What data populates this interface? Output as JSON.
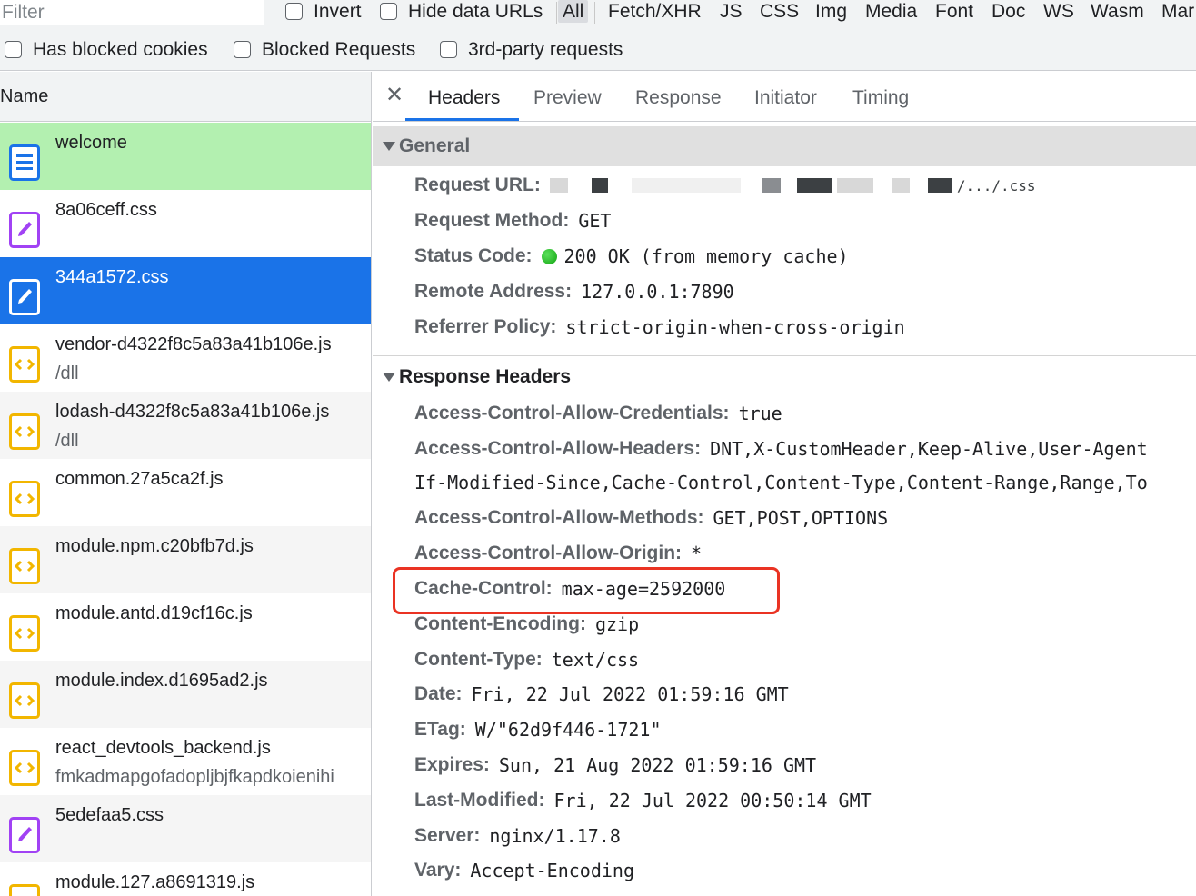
{
  "filter": {
    "placeholder": "Filter",
    "invert_label": "Invert",
    "hide_data_urls_label": "Hide data URLs",
    "types": [
      "All",
      "Fetch/XHR",
      "JS",
      "CSS",
      "Img",
      "Media",
      "Font",
      "Doc",
      "WS",
      "Wasm",
      "Mar"
    ],
    "has_blocked_cookies_label": "Has blocked cookies",
    "blocked_requests_label": "Blocked Requests",
    "third_party_label": "3rd-party requests"
  },
  "list": {
    "header": "Name",
    "requests": [
      {
        "name": "welcome",
        "sub": "",
        "kind": "doc",
        "state": "selected-green"
      },
      {
        "name": "8a06ceff.css",
        "sub": "",
        "kind": "css",
        "state": ""
      },
      {
        "name": "344a1572.css",
        "sub": "",
        "kind": "css",
        "state": "selected-blue"
      },
      {
        "name": "vendor-d4322f8c5a83a41b106e.js",
        "sub": "/dll",
        "kind": "js",
        "state": ""
      },
      {
        "name": "lodash-d4322f8c5a83a41b106e.js",
        "sub": "/dll",
        "kind": "js",
        "state": ""
      },
      {
        "name": "common.27a5ca2f.js",
        "sub": "",
        "kind": "js",
        "state": ""
      },
      {
        "name": "module.npm.c20bfb7d.js",
        "sub": "",
        "kind": "js",
        "state": ""
      },
      {
        "name": "module.antd.d19cf16c.js",
        "sub": "",
        "kind": "js",
        "state": ""
      },
      {
        "name": "module.index.d1695ad2.js",
        "sub": "",
        "kind": "js",
        "state": ""
      },
      {
        "name": "react_devtools_backend.js",
        "sub": "fmkadmapgofadopljbjfkapdkoienihi",
        "kind": "js",
        "state": ""
      },
      {
        "name": "5edefaa5.css",
        "sub": "",
        "kind": "css",
        "state": ""
      },
      {
        "name": "module.127.a8691319.js",
        "sub": "",
        "kind": "js",
        "state": ""
      }
    ]
  },
  "details": {
    "tabs": [
      "Headers",
      "Preview",
      "Response",
      "Initiator",
      "Timing"
    ],
    "active_tab": "Headers",
    "general": {
      "title": "General",
      "request_url_key": "Request URL:",
      "request_url_tail": "/.../.css",
      "rows": [
        {
          "key": "Request Method:",
          "value": "GET"
        },
        {
          "key": "Status Code:",
          "value": "200 OK (from memory cache)"
        },
        {
          "key": "Remote Address:",
          "value": "127.0.0.1:7890"
        },
        {
          "key": "Referrer Policy:",
          "value": "strict-origin-when-cross-origin"
        }
      ]
    },
    "response_headers": {
      "title": "Response Headers",
      "rows": [
        {
          "key": "Access-Control-Allow-Credentials:",
          "value": "true"
        },
        {
          "key": "Access-Control-Allow-Headers:",
          "value": "DNT,X-CustomHeader,Keep-Alive,User-Agent"
        },
        {
          "key": "",
          "value": "If-Modified-Since,Cache-Control,Content-Type,Content-Range,Range,To"
        },
        {
          "key": "Access-Control-Allow-Methods:",
          "value": "GET,POST,OPTIONS"
        },
        {
          "key": "Access-Control-Allow-Origin:",
          "value": "*"
        },
        {
          "key": "Cache-Control:",
          "value": "max-age=2592000"
        },
        {
          "key": "Content-Encoding:",
          "value": "gzip"
        },
        {
          "key": "Content-Type:",
          "value": "text/css"
        },
        {
          "key": "Date:",
          "value": "Fri, 22 Jul 2022 01:59:16 GMT"
        },
        {
          "key": "ETag:",
          "value": "W/\"62d9f446-1721\""
        },
        {
          "key": "Expires:",
          "value": "Sun, 21 Aug 2022 01:59:16 GMT"
        },
        {
          "key": "Last-Modified:",
          "value": "Fri, 22 Jul 2022 00:50:14 GMT"
        },
        {
          "key": "Server:",
          "value": "nginx/1.17.8"
        },
        {
          "key": "Vary:",
          "value": "Accept-Encoding"
        }
      ]
    }
  },
  "icons": {
    "doc": "document-icon",
    "css": "stylesheet-icon",
    "js": "script-icon",
    "close": "close-icon",
    "status_ok": "status-ok-dot-icon"
  },
  "colors": {
    "accent": "#1a73e8",
    "selected_green": "#b3f0b0",
    "highlight_box": "#ea3323",
    "js_icon": "#f2b600",
    "css_icon": "#a142f4",
    "doc_icon": "#1a73e8",
    "status_ok": "#1e8e3e"
  }
}
